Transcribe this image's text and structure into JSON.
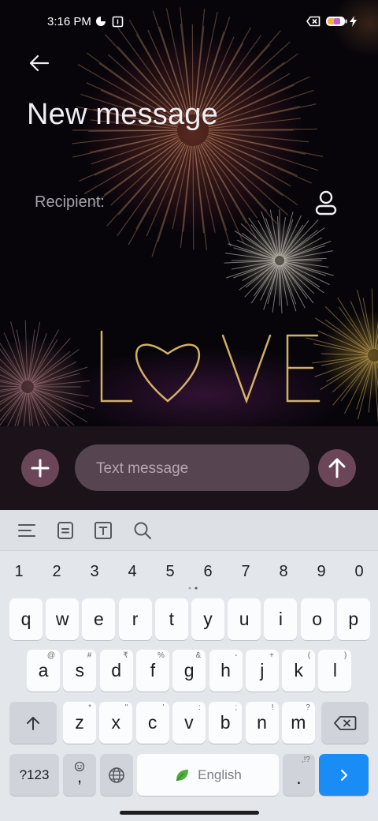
{
  "status_bar": {
    "time": "3:16 PM",
    "icons": [
      "data-saver-icon",
      "sim-icon",
      "no-sim-icon",
      "battery-icon",
      "charging-icon"
    ],
    "battery_level": "38"
  },
  "header": {
    "back_icon": "arrow-left-icon",
    "title": "New message"
  },
  "recipient": {
    "label": "Recipient:",
    "contact_icon": "person-icon"
  },
  "wallpaper": {
    "text": "LOVE"
  },
  "compose": {
    "attach_icon": "plus-icon",
    "placeholder": "Text message",
    "send_icon": "arrow-up-icon"
  },
  "keyboard": {
    "toolbar": [
      "menu-icon",
      "clipboard-icon",
      "text-format-icon",
      "search-icon"
    ],
    "numbers": [
      "1",
      "2",
      "3",
      "4",
      "5",
      "6",
      "7",
      "8",
      "9",
      "0"
    ],
    "row1": [
      "q",
      "w",
      "e",
      "r",
      "t",
      "y",
      "u",
      "i",
      "o",
      "p"
    ],
    "row2": [
      {
        "key": "a",
        "hint": "@"
      },
      {
        "key": "s",
        "hint": "#"
      },
      {
        "key": "d",
        "hint": "₹"
      },
      {
        "key": "f",
        "hint": "%"
      },
      {
        "key": "g",
        "hint": "&"
      },
      {
        "key": "h",
        "hint": "-"
      },
      {
        "key": "j",
        "hint": "+"
      },
      {
        "key": "k",
        "hint": "("
      },
      {
        "key": "l",
        "hint": ")"
      }
    ],
    "row3": [
      {
        "key": "z",
        "hint": "*"
      },
      {
        "key": "x",
        "hint": "\""
      },
      {
        "key": "c",
        "hint": "'"
      },
      {
        "key": "v",
        "hint": ":"
      },
      {
        "key": "b",
        "hint": ";"
      },
      {
        "key": "n",
        "hint": "!"
      },
      {
        "key": "m",
        "hint": "?"
      }
    ],
    "symbols_label": "?123",
    "comma_label": ",",
    "space_label": "English",
    "period_label": ".",
    "period_hint": ",!?",
    "accent_color": "#1a8cf5"
  }
}
